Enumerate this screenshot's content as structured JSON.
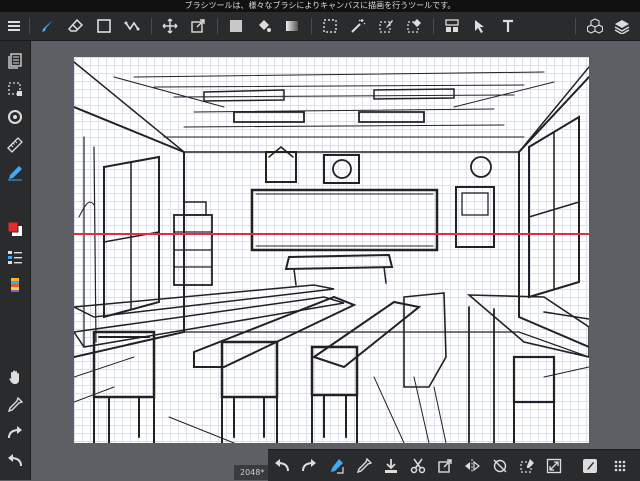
{
  "hint": "ブラシツールは、様々なブラシによりキャンバスに描画を行うツールです。",
  "toolbar": {
    "items": [
      {
        "name": "menu-icon"
      },
      {
        "name": "brush-icon"
      },
      {
        "name": "eraser-icon"
      },
      {
        "name": "rectangle-icon"
      },
      {
        "name": "curve-icon"
      },
      {
        "name": "move-icon"
      },
      {
        "name": "transform-icon"
      },
      {
        "name": "fill-color-icon"
      },
      {
        "name": "bucket-icon"
      },
      {
        "name": "gradient-icon"
      },
      {
        "name": "select-rect-icon"
      },
      {
        "name": "magic-wand-icon"
      },
      {
        "name": "select-pen-icon"
      },
      {
        "name": "select-eraser-icon"
      },
      {
        "name": "layout-icon"
      },
      {
        "name": "select-move-icon"
      },
      {
        "name": "text-icon"
      },
      {
        "name": "material-icon"
      },
      {
        "name": "layers-icon"
      }
    ]
  },
  "sidebar": {
    "items": [
      {
        "name": "pages-icon"
      },
      {
        "name": "selection-icon"
      },
      {
        "name": "snap-icon"
      },
      {
        "name": "ruler-icon"
      },
      {
        "name": "pen-icon"
      },
      {
        "name": "color-icon"
      },
      {
        "name": "brush-list-icon"
      },
      {
        "name": "palette-icon"
      },
      {
        "name": "hand-icon"
      },
      {
        "name": "eyedropper-icon"
      },
      {
        "name": "redo-icon"
      },
      {
        "name": "undo-icon"
      }
    ]
  },
  "colors": {
    "primary": "#e52b2b",
    "secondary": "#ffffff",
    "accent": "#3fa9f5"
  },
  "status": {
    "size_text": "2048*"
  },
  "bottom": {
    "items": [
      {
        "name": "undo-icon"
      },
      {
        "name": "redo-icon"
      },
      {
        "name": "brush-edit-icon"
      },
      {
        "name": "eyedropper-icon"
      },
      {
        "name": "import-icon"
      },
      {
        "name": "cut-icon"
      },
      {
        "name": "transform-icon"
      },
      {
        "name": "flip-icon"
      },
      {
        "name": "rotate-icon"
      },
      {
        "name": "fill-select-icon"
      },
      {
        "name": "fullscreen-icon"
      },
      {
        "name": "brush-size-icon"
      },
      {
        "name": "grid-menu-icon"
      }
    ]
  }
}
